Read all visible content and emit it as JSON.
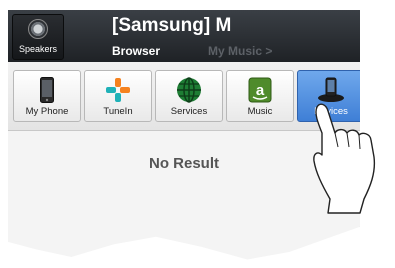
{
  "header": {
    "speakers_label": "Speakers",
    "title": "[Samsung] M",
    "breadcrumb_current": "Browser",
    "breadcrumb_next": "My Music >"
  },
  "tabs": [
    {
      "label": "My Phone",
      "icon": "phone-icon"
    },
    {
      "label": "TuneIn",
      "icon": "tunein-icon"
    },
    {
      "label": "Services",
      "icon": "globe-icon"
    },
    {
      "label": "Music",
      "icon": "amazon-icon"
    },
    {
      "label": "Devices",
      "icon": "devices-icon",
      "active": true
    }
  ],
  "content": {
    "message": "No Result"
  },
  "colors": {
    "header_bg": "#2b2f34",
    "active_tab": "#4a8ae0",
    "tunein_orange": "#f5821f",
    "tunein_teal": "#1fb1b8",
    "globe_green": "#1e7d34",
    "amazon_green": "#4f8b2b"
  }
}
